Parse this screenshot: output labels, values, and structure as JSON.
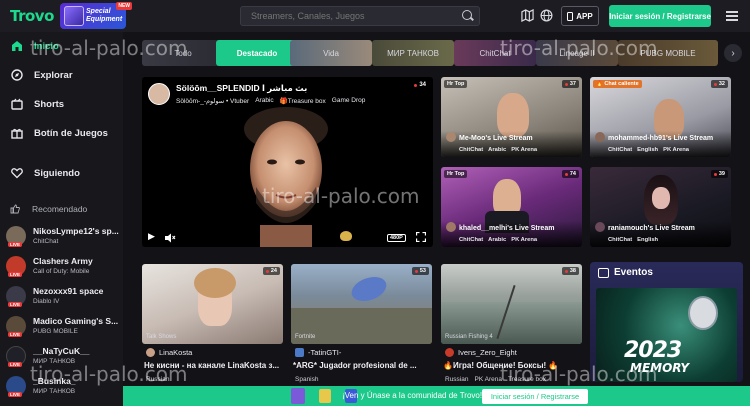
{
  "header": {
    "logo": "Trovo",
    "promo_line1": "Special",
    "promo_line2": "Equipment",
    "promo_badge": "NEW",
    "search_placeholder": "Streamers, Canales, Juegos",
    "app_label": "APP",
    "login_label": "Iniciar sesión / Registrarse"
  },
  "sidebar": {
    "items": [
      {
        "label": "Inicio",
        "icon": "home-icon"
      },
      {
        "label": "Explorar",
        "icon": "compass-icon"
      },
      {
        "label": "Shorts",
        "icon": "shorts-icon"
      },
      {
        "label": "Botín de Juegos",
        "icon": "gift-icon"
      },
      {
        "label": "Siguiendo",
        "icon": "heart-icon"
      }
    ],
    "recommended_label": "Recomendado",
    "recommended": [
      {
        "name": "NikosLympe12's sp...",
        "game": "ChitChat",
        "color": "#7a6a5a",
        "live": "LIVE"
      },
      {
        "name": "Clashers Army",
        "game": "Call of Duty: Mobile",
        "color": "#c23a2a",
        "live": "LIVE"
      },
      {
        "name": "Nezoxxx91 space",
        "game": "Diablo IV",
        "color": "#3a3a48",
        "live": "LIVE"
      },
      {
        "name": "Madico Gaming's S...",
        "game": "PUBG MOBILE",
        "color": "#5a4a3a",
        "live": "LIVE"
      },
      {
        "name": "__NaTyCuK__",
        "game": "МИР ТАНКОВ",
        "color": "#202028",
        "live": "LIVE"
      },
      {
        "name": "_Businka_",
        "game": "МИР ТАНКОВ",
        "color": "#2a4a8a",
        "live": "LIVE"
      }
    ]
  },
  "categories": [
    {
      "label": "Todo"
    },
    {
      "label": "Destacado"
    },
    {
      "label": "Vida"
    },
    {
      "label": "МИР ТАНКОВ"
    },
    {
      "label": "ChitChat"
    },
    {
      "label": "Lineage II"
    },
    {
      "label": "PUBG MOBILE"
    }
  ],
  "featured": {
    "title": "Sölöōm__SPLENDID بث مباشر ا",
    "subtitle": "Sölöōm-_-سولوم • Vtuber",
    "chips": [
      "Arabic",
      "Treasure box",
      "Game Drop"
    ],
    "viewers": "34",
    "quality": "480P"
  },
  "cards": [
    {
      "tag": "Hr Top",
      "viewers": "37",
      "name": "Me-Moo's Live Stream",
      "chips": [
        "ChitChat",
        "Arabic",
        "PK Arena"
      ]
    },
    {
      "tag": "Chat caliente",
      "viewers": "32",
      "name": "mohammed-hb91's Live Stream",
      "chips": [
        "ChitChat",
        "English",
        "PK Arena"
      ]
    },
    {
      "tag": "Hr Top",
      "viewers": "74",
      "name": "khaled__melhi's Live Stream",
      "chips": [
        "ChitChat",
        "Arabic",
        "PK Arena"
      ]
    },
    {
      "tag": "",
      "viewers": "39",
      "name": "raniamouch's Live Stream",
      "chips": [
        "ChitChat",
        "English"
      ]
    }
  ],
  "bottom_cards": [
    {
      "viewers": "24",
      "category": "Talk Shows",
      "streamer": "LinaKosta",
      "title": "Не кисни - на канале LinaKosta з...",
      "chips": [
        "Russian"
      ]
    },
    {
      "viewers": "53",
      "category": "Fortnite",
      "streamer": "-TatinGTI-",
      "title": "*ARG* Jugador profesional de ...",
      "chips": [
        "Spanish"
      ]
    },
    {
      "viewers": "38",
      "category": "Russian Fishing 4",
      "streamer": "Ivens_Zero_Eight",
      "title": "🔥Игра! Общение! Боксы! 🔥",
      "chips": [
        "Russian",
        "PK Arena",
        "Treasure box"
      ]
    }
  ],
  "events": {
    "title": "Eventos",
    "year": "2023",
    "word": "MEMORY"
  },
  "banner": {
    "text": "¡Ven y Únase a la comunidad de Trovo!",
    "button": "Iniciar sesión / Registrarse"
  },
  "watermark": "tiro-al-palo.com"
}
